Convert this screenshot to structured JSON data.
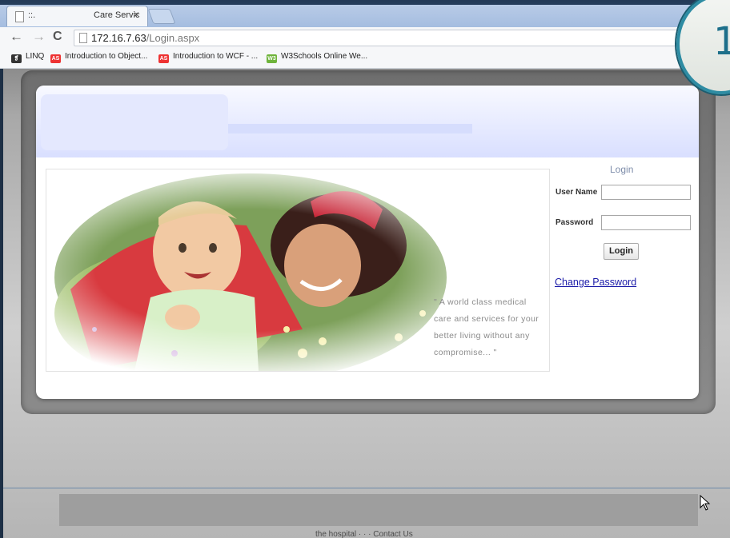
{
  "browser": {
    "tab_title_left": "::.",
    "tab_title_right": "Care Servic",
    "tab_close": "×",
    "nav_back": "←",
    "nav_forward": "→",
    "nav_reload": "C",
    "url_host": "172.16.7.63",
    "url_path": "/Login.aspx",
    "bookmarks": [
      {
        "label": "LINQ",
        "icon": "pin-icon",
        "badge": "❡"
      },
      {
        "label": "Introduction to Object...",
        "icon": "as-icon",
        "badge": "AS"
      },
      {
        "label": "Introduction to WCF - ...",
        "icon": "as-icon",
        "badge": "AS"
      },
      {
        "label": "W3Schools Online We...",
        "icon": "w3-icon",
        "badge": "W3"
      }
    ]
  },
  "login": {
    "title": "Login",
    "username_label": "User Name",
    "username_value": "",
    "password_label": "Password",
    "password_value": "",
    "button": "Login",
    "change_password": "Change Password"
  },
  "tagline": "\" A world class medical care and services for your better living without any compromise... \"",
  "footer_text": "the hospital  ·  ·  ·  Contact Us",
  "overlay_number": "1",
  "colors": {
    "link": "#1a1aa8",
    "accent": "#7e8daa",
    "badge": "#2e8ca3"
  }
}
